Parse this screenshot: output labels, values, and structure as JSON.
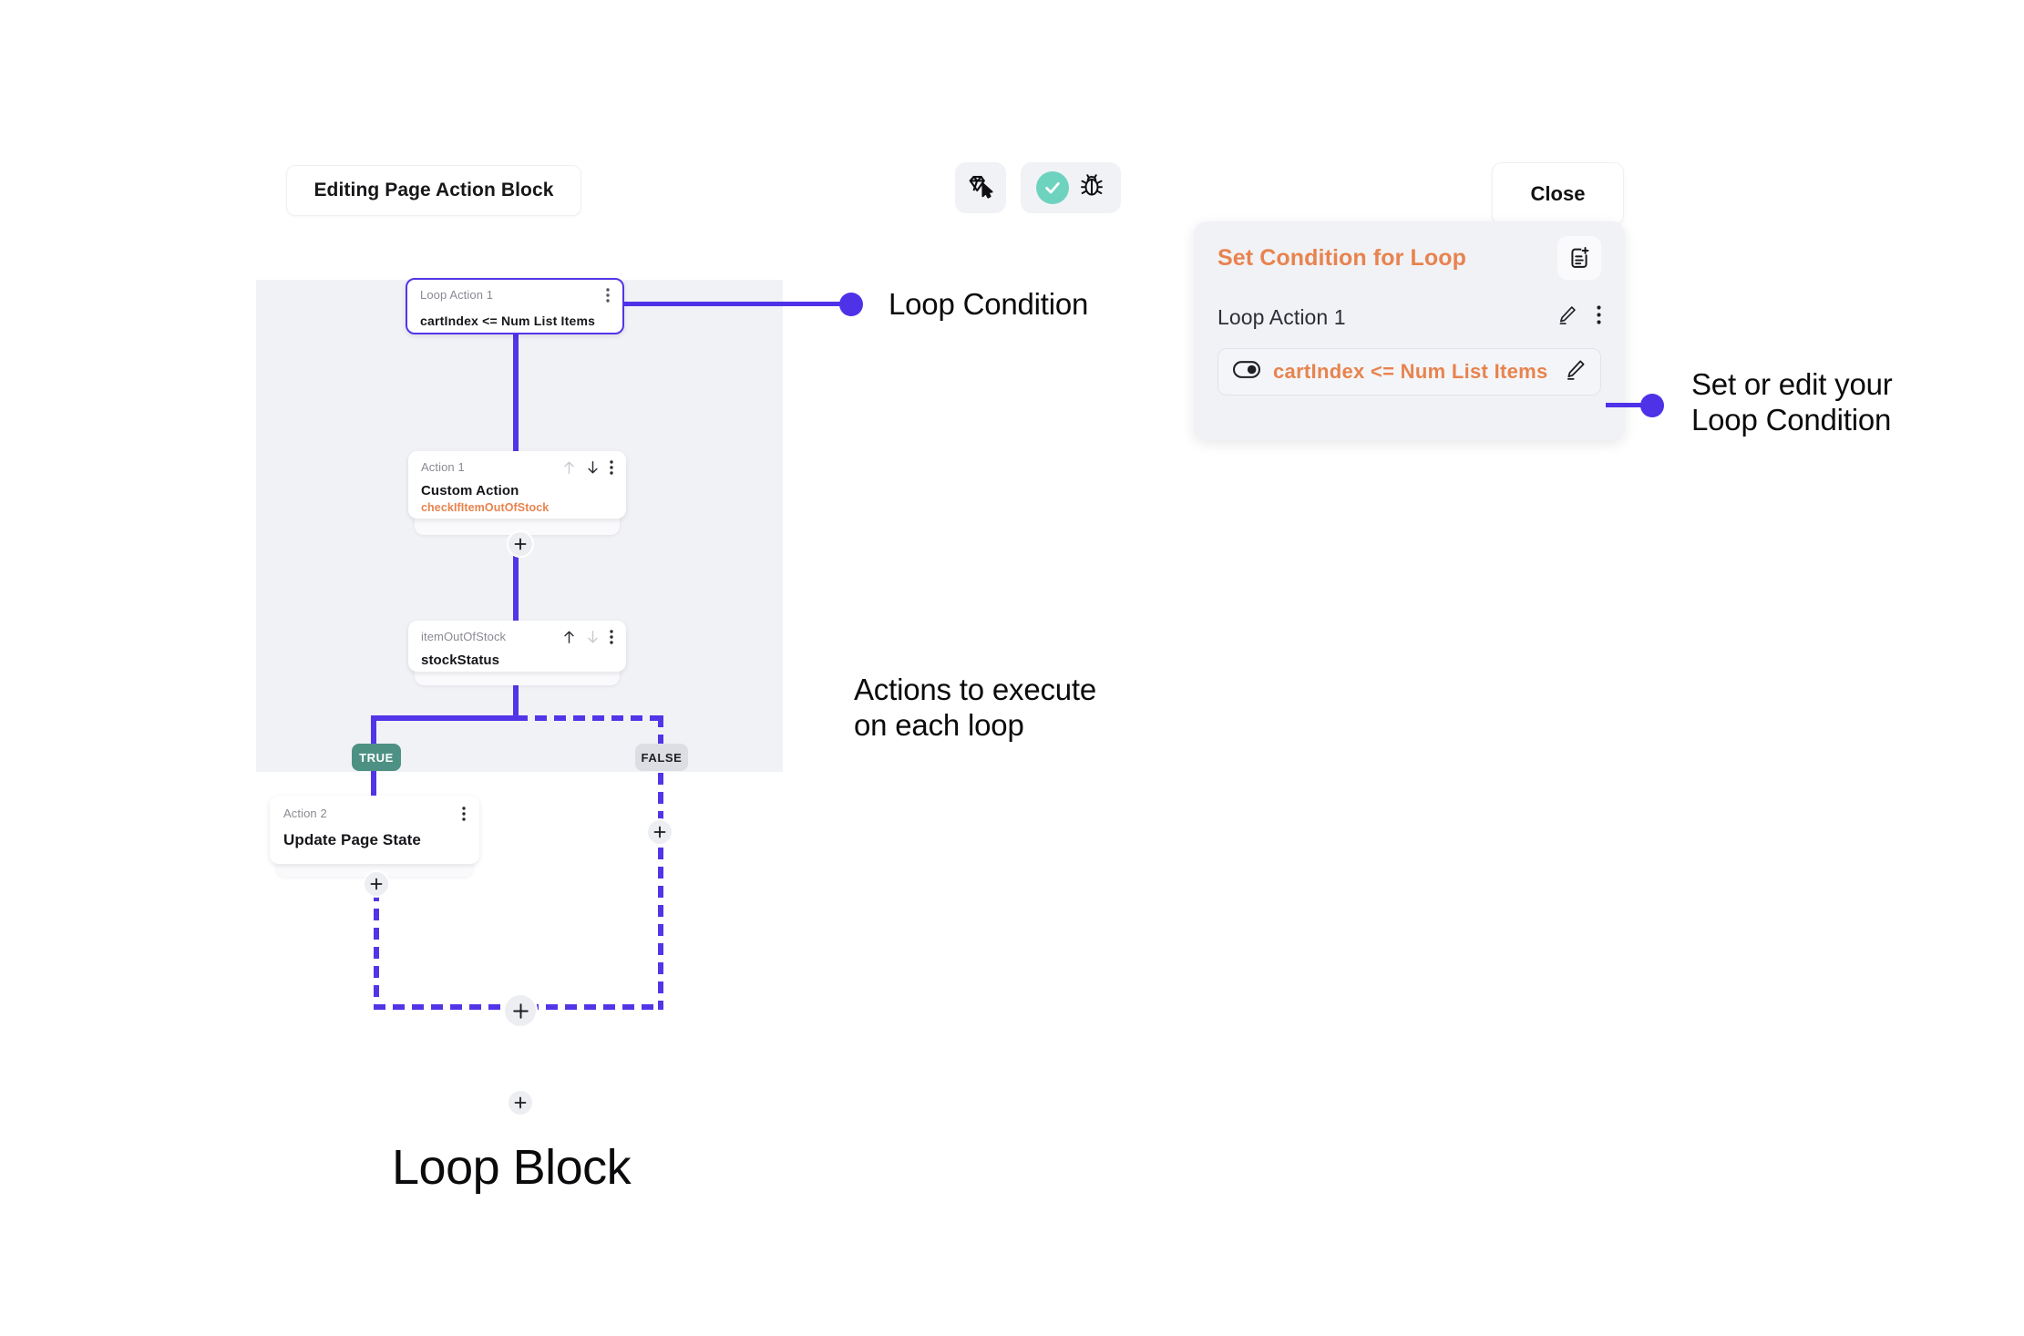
{
  "header": {
    "editing_chip_label": "Editing Page Action Block",
    "close_label": "Close",
    "toolbar": {
      "left_icon": "gem-cursor-icon",
      "check_icon": "check-circle-icon",
      "bug_icon": "bug-icon"
    }
  },
  "canvas": {
    "nodes": {
      "loop": {
        "sub": "Loop Action 1",
        "condition": "cartIndex  <=  Num List Items",
        "menu_icon": "more-vertical-icon",
        "border_color": "#5335E8"
      },
      "action1": {
        "sub": "Action 1",
        "title": "Custom Action",
        "detail": "checkIfItemOutOfStock",
        "detail_color": "#E8834E",
        "up_icon": "arrow-up-icon",
        "down_icon": "arrow-down-icon",
        "menu_icon": "more-vertical-icon"
      },
      "stock": {
        "sub": "itemOutOfStock",
        "title": "stockStatus",
        "up_icon": "arrow-up-icon",
        "down_icon": "arrow-down-icon",
        "menu_icon": "more-vertical-icon"
      },
      "action2": {
        "sub": "Action 2",
        "title": "Update Page State",
        "menu_icon": "more-vertical-icon"
      }
    },
    "branches": {
      "true_label": "TRUE",
      "true_color": "#4C9184",
      "false_label": "FALSE",
      "false_color": "#DCDEE4"
    },
    "connector_color": "#5335E8",
    "background": "#F1F2F6",
    "add_icon": "plus-icon"
  },
  "panel": {
    "title": "Set Condition for Loop",
    "title_color": "#E8834E",
    "doc_add_icon": "document-add-icon",
    "loop_action_label": "Loop Action 1",
    "edit_icon": "pencil-icon",
    "menu_icon": "more-vertical-icon",
    "condition": {
      "toggle_icon": "toggle-off-icon",
      "text": "cartIndex  <=  Num List Items",
      "edit_icon": "pencil-icon"
    }
  },
  "annotations": {
    "loop_condition": "Loop Condition",
    "actions_each_loop": "Actions to execute\non each loop",
    "set_or_edit": "Set or edit your\nLoop Condition",
    "dot_color": "#4D32E8"
  },
  "footer": {
    "loop_block_title": "Loop Block"
  }
}
